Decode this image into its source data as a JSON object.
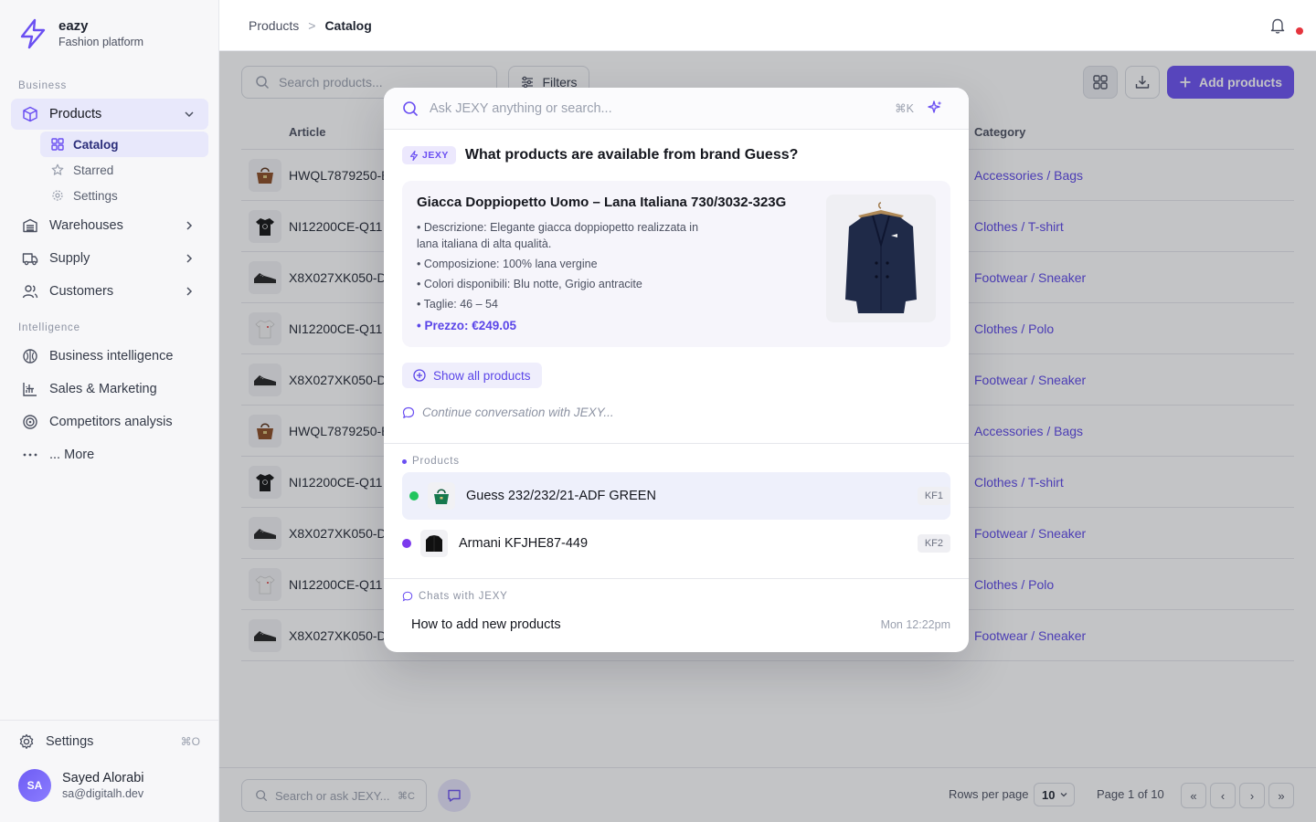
{
  "brand": {
    "name": "eazy",
    "tagline": "Fashion platform"
  },
  "sidebar": {
    "section_business": "Business",
    "products": "Products",
    "sub": [
      {
        "label": "Catalog"
      },
      {
        "label": "Starred"
      },
      {
        "label": "Settings"
      }
    ],
    "warehouses": "Warehouses",
    "supply": "Supply",
    "customers": "Customers",
    "section_intelligence": "Intelligence",
    "intel": [
      {
        "label": "Business intelligence"
      },
      {
        "label": "Sales & Marketing"
      },
      {
        "label": "Competitors analysis"
      },
      {
        "label": "... More"
      }
    ],
    "settings": "Settings",
    "settings_kbd": "⌘O",
    "user": {
      "initials": "SA",
      "name": "Sayed Alorabi",
      "email": "sa@digitalh.dev"
    }
  },
  "breadcrumb": {
    "parent": "Products",
    "sep": ">",
    "current": "Catalog"
  },
  "toolbar": {
    "search_placeholder": "Search products...",
    "filters": "Filters",
    "add": "Add products"
  },
  "table": {
    "col_article": "Article",
    "col_category": "Category",
    "rows": [
      {
        "article": "HWQL7879250-BRN",
        "category": "Accessories / Bags"
      },
      {
        "article": "NI12200CE-Q11",
        "category": "Clothes / T-shirt"
      },
      {
        "article": "X8X027XK050-D",
        "category": "Footwear / Sneaker"
      },
      {
        "article": "NI12200CE-Q11",
        "category": "Clothes / Polo"
      },
      {
        "article": "X8X027XK050-D",
        "category": "Footwear / Sneaker"
      },
      {
        "article": "HWQL7879250-BRN",
        "category": "Accessories / Bags"
      },
      {
        "article": "NI12200CE-Q11",
        "category": "Clothes / T-shirt"
      },
      {
        "article": "X8X027XK050-D",
        "category": "Footwear / Sneaker"
      },
      {
        "article": "NI12200CE-Q11",
        "category": "Clothes / Polo"
      },
      {
        "article": "X8X027XK050-D",
        "category": "Footwear / Sneaker"
      }
    ]
  },
  "footer": {
    "search_placeholder": "Search or ask JEXY...",
    "search_kbd": "⌘C",
    "rows_per_page_label": "Rows per page",
    "rows_per_page": "10",
    "page_of": "Page 1 of 10",
    "nav": [
      "«",
      "‹",
      "›",
      "»"
    ]
  },
  "palette": {
    "placeholder": "Ask JEXY anything or search...",
    "kbd": "⌘K",
    "badge": "JEXY",
    "question": "What products are available from brand Guess?",
    "product_title": "Giacca Doppiopetto Uomo – Lana Italiana 730/3032-323G",
    "bullets": [
      "• Descrizione: Elegante giacca doppiopetto realizzata in lana italiana di alta qualità.",
      "• Composizione: 100% lana vergine",
      "• Colori disponibili: Blu notte, Grigio antracite",
      "• Taglie: 46 – 54"
    ],
    "price": "• Prezzo: €249.05",
    "show_all": "Show all products",
    "continue": "Continue conversation with JEXY...",
    "products_group": "Products",
    "items": [
      {
        "label": "Guess 232/232/21-ADF GREEN",
        "kbd": "KF1",
        "status_color": "#22c55e"
      },
      {
        "label": "Armani KFJHE87-449",
        "kbd": "KF2",
        "status_color": "#7c3aed"
      }
    ],
    "chats_group": "Chats with JEXY",
    "chat": {
      "title": "How to add new products",
      "time": "Mon 12:22pm"
    }
  },
  "colors": {
    "accent": "#6a4ff2",
    "link": "#5a45e8",
    "notification": "#e5343d"
  }
}
